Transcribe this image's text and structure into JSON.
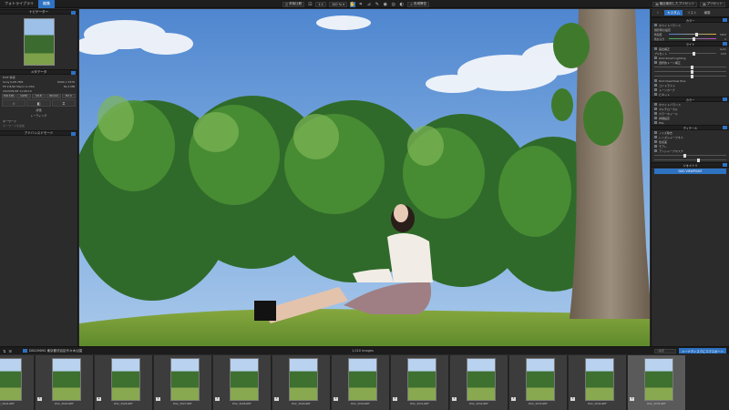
{
  "topbar": {
    "tabs": [
      "フォトライブラリ",
      "編集"
    ],
    "active_tab": 1,
    "buttons": [
      "前後比較",
      "1:1",
      "100 %",
      "色域警告"
    ],
    "right": [
      "最近使用したプリセット",
      "プリセット"
    ]
  },
  "left_panel": {
    "navigator_title": "ナビゲーター",
    "navigator_tabs": [
      "ヒストグラム"
    ],
    "metadata_title": "メタデータ",
    "exif_header": "EXIF 情報",
    "camera": "Sony ILCE-7M4",
    "size": "6000 x 3376",
    "lens": "FE 2.8/90 Macro G OSS",
    "date": "2023/05/28 11:06:10",
    "file_size": "64.2 MB",
    "chips": [
      "ISO 100",
      "1/250",
      "f/2.8",
      "90 mm",
      "EV 0"
    ],
    "buttons": [
      "☆",
      "◧",
      "⌗"
    ],
    "rating_title": "評価",
    "rating_label": "レーティング",
    "keywords_title": "キーワード",
    "keywords_placeholder": "キーワードを追加",
    "palette_title": "アドバンスドモード"
  },
  "right_panel": {
    "tabs": [
      "カスタム",
      "リスト",
      "編集"
    ],
    "sections": {
      "color": "カラー",
      "detail": "ディテール",
      "light": "ライト",
      "geometry": "ジオメトリ"
    },
    "items_color": [
      "ホワイトバランス",
      "マルチローカル",
      "カラーホイール",
      "詳細設定",
      "HSL"
    ],
    "items_light": [
      "露出補正",
      "DxO Smart Lighting",
      "選択的トーン補正",
      "DxO ClearView Plus",
      "コントラスト",
      "トーンカーブ",
      "ビネット"
    ],
    "items_detail": [
      "ノイズ除去",
      "レンズシャープネス",
      "色収差",
      "モアレ",
      "アンシャープマスク"
    ],
    "wb_preset": "ホワイトバランス",
    "wb_mode": "撮影時の設定",
    "temp_label": "色温度",
    "temp_value": "5200",
    "tint_label": "色かぶり",
    "tint_value": "0",
    "exposure_label": "プリセット",
    "exposure_value": "0.00",
    "auto_label": "Auto",
    "viewpoint": "DXO VIEWPOINT"
  },
  "filmbar": {
    "folder": "DSC09092 東京都渋谷区代々木公園",
    "count": "1,010 images",
    "search_placeholder": "検索",
    "export": "ハードディスクにエクスポート"
  },
  "filmstrip": {
    "items": [
      {
        "name": "DSC_3024.NEF",
        "badge": "★"
      },
      {
        "name": "DSC_3025.NEF",
        "badge": "1"
      },
      {
        "name": "DSC_3026.NEF",
        "badge": "★"
      },
      {
        "name": "DSC_3027.NEF",
        "badge": "1"
      },
      {
        "name": "DSC_3028.NEF",
        "badge": "1"
      },
      {
        "name": "DSC_3029.NEF",
        "badge": "1"
      },
      {
        "name": "DSC_3030.NEF",
        "badge": "1"
      },
      {
        "name": "DSC_3031.NEF",
        "badge": "1"
      },
      {
        "name": "DSC_3032.NEF",
        "badge": "1"
      },
      {
        "name": "DSC_3033.NEF",
        "badge": "1"
      },
      {
        "name": "DSC_3034.NEF",
        "badge": "1"
      },
      {
        "name": "DSC_3035.NEF",
        "badge": "1"
      }
    ]
  }
}
